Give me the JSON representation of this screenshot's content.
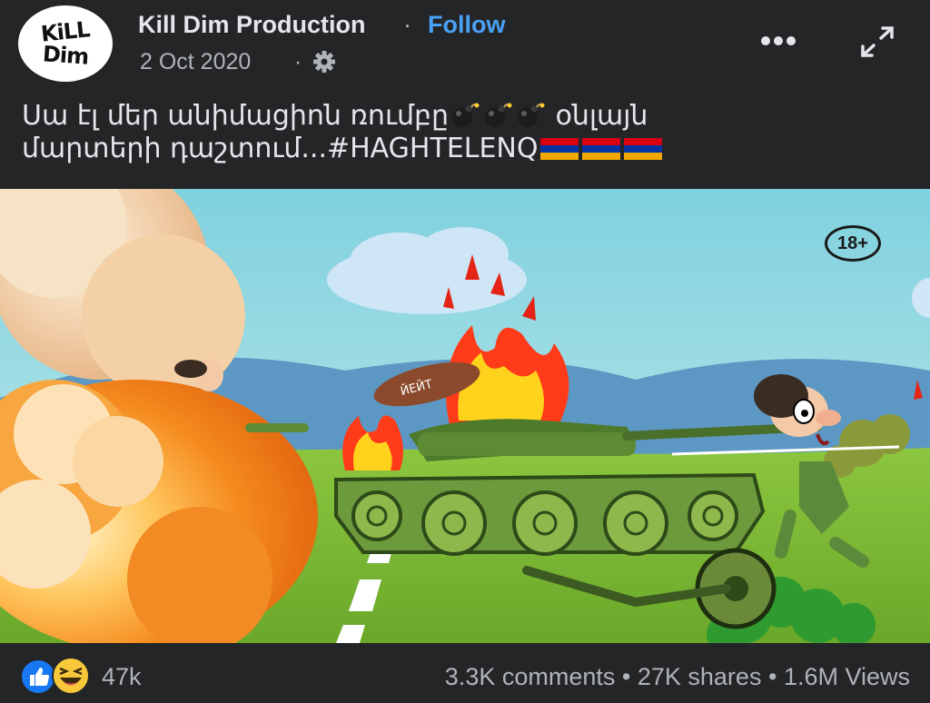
{
  "post": {
    "page_name": "Kill Dim Production",
    "separator": "·",
    "follow_label": "Follow",
    "date": "2 Oct 2020",
    "avatar_line1": "KiLL",
    "avatar_line2": "Dim",
    "caption_line1": "Սա էլ մեր անիմացիոն ռումբը",
    "caption_line1_end": "օնլայն",
    "caption_line2": "մարտերի դաշտում...#HAGHTELENQ",
    "privacy_icon": "gear-icon",
    "more_icon": "more-dots-icon",
    "expand_icon": "expand-icon"
  },
  "media": {
    "age_rating": "18+",
    "tank_sign": "ЙЕЙТ"
  },
  "footer": {
    "reaction_count": "47k",
    "comments": "3.3K comments",
    "shares": "27K shares",
    "views": "1.6M Views",
    "dot": "•"
  },
  "colors": {
    "background": "#242526",
    "link": "#4aa0f5",
    "text": "#e4e6eb",
    "muted": "#b0b3b8"
  }
}
